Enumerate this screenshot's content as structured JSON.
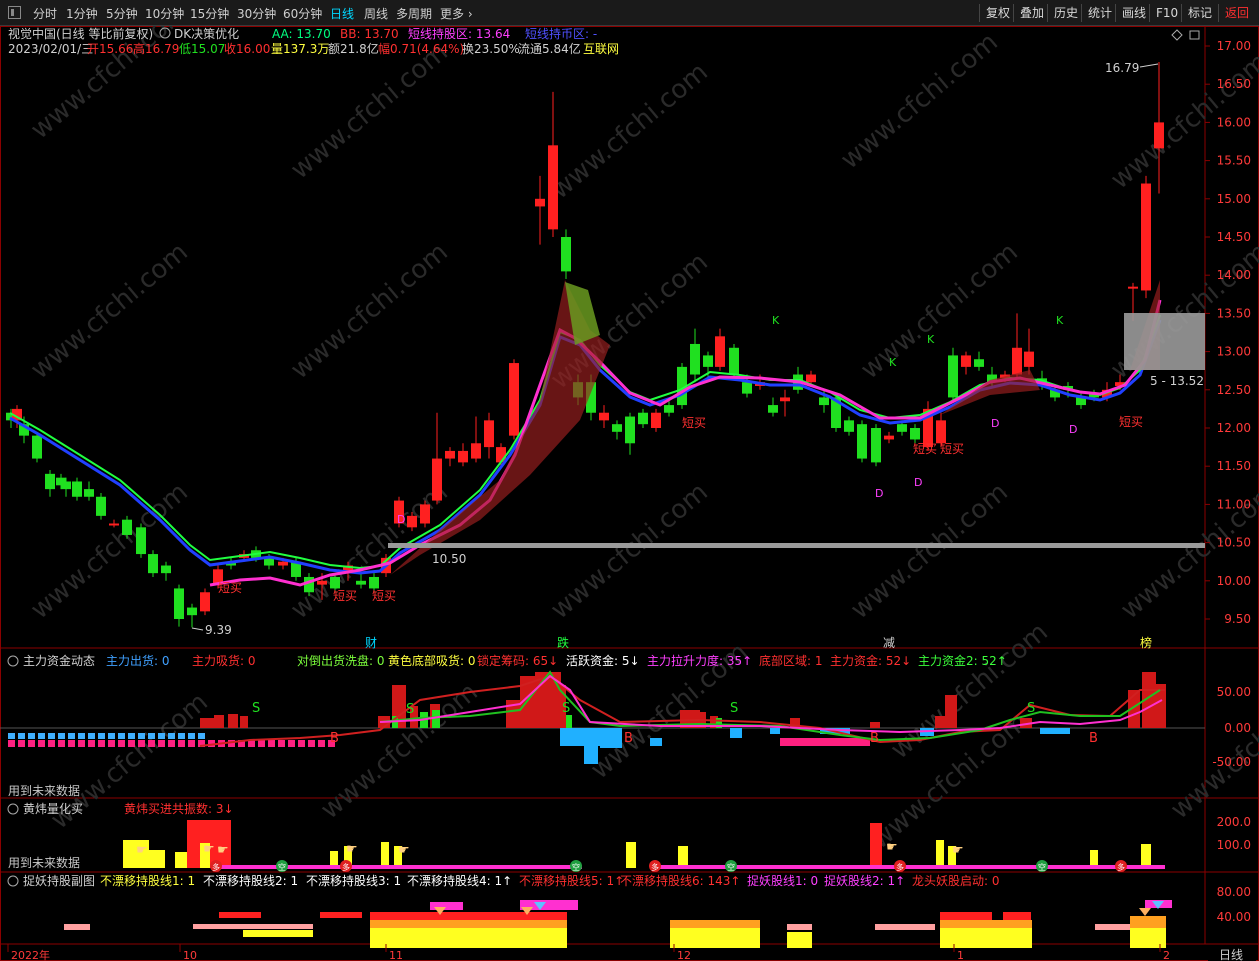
{
  "toolbar": {
    "periods": [
      "分时",
      "1分钟",
      "5分钟",
      "10分钟",
      "15分钟",
      "30分钟",
      "60分钟",
      "日线",
      "周线",
      "多周期",
      "更多"
    ],
    "active_period": "日线",
    "right_buttons": [
      "复权",
      "叠加",
      "历史",
      "统计",
      "画线",
      "F10",
      "标记",
      "返回"
    ]
  },
  "header": {
    "stock": "视觉中国(日线 等比前复权)",
    "indicator": "DK决策优化",
    "aa": "AA: 13.70",
    "bb": "BB: 13.70",
    "hold_zone": "短线持股区: 13.64",
    "coin_zone": "短线持币区: -",
    "date": "2023/02/01/三",
    "open": "开15.66",
    "high": "高16.79",
    "low": "低15.07",
    "close": "收16.00",
    "volume": "量137.3万",
    "amount": "额21.8亿",
    "change": "幅0.71(4.64%)",
    "turnover": "换23.50%",
    "float": "流通5.84亿",
    "sector": "互联网"
  },
  "price_axis": [
    "17.00",
    "16.50",
    "16.00",
    "15.50",
    "15.00",
    "14.50",
    "14.00",
    "13.50",
    "13.00",
    "12.50",
    "12.00",
    "11.50",
    "11.00",
    "10.50",
    "10.00",
    "9.50"
  ],
  "annotations": {
    "high_mark": "16.79",
    "low_mark": "9.39",
    "support": "10.50",
    "box_label": "5 - 13.52",
    "short_buy": "短买",
    "event_cai": "财",
    "event_die": "跌",
    "event_jian": "减",
    "event_bang": "榜",
    "mark_d": "D",
    "mark_k": "K",
    "mark_s": "S",
    "mark_b": "B"
  },
  "panel1": {
    "title": "主力资金动态",
    "items": [
      {
        "t": "主力出货: 0",
        "c": "#3fa0ff"
      },
      {
        "t": "主力吸货: 0",
        "c": "#ff3030"
      },
      {
        "t": "对倒出货洗盘: 0",
        "c": "#7cff3c"
      },
      {
        "t": "黄色底部吸货: 0",
        "c": "#ffff40"
      },
      {
        "t": "锁定筹码: 65↓",
        "c": "#ff3030"
      },
      {
        "t": "活跃资金: 5↓",
        "c": "#ffffff"
      },
      {
        "t": "主力拉升力度: 35↑",
        "c": "#ff40ff"
      },
      {
        "t": "底部区域: 1",
        "c": "#ff3030"
      },
      {
        "t": "主力资金: 52↓",
        "c": "#ff3030"
      },
      {
        "t": "主力资金2: 52↑",
        "c": "#3cff3c"
      }
    ],
    "axis": [
      "50.00",
      "0.00",
      "-50.00"
    ],
    "future": "用到未来数据"
  },
  "panel2": {
    "title": "黄炜量化买",
    "item": "黄炜买进共振数: 3↓",
    "axis": [
      "200.0",
      "100.0"
    ],
    "future": "用到未来数据",
    "kong": "空",
    "duo": "多"
  },
  "panel3": {
    "title": "捉妖持股副图",
    "items": [
      {
        "t": "不漂移持股线1: 1",
        "c": "#ffff40"
      },
      {
        "t": "不漂移持股线2: 1",
        "c": "#ffffff"
      },
      {
        "t": "不漂移持股线3: 1",
        "c": "#ffffff"
      },
      {
        "t": "不漂移持股线4: 1↑",
        "c": "#ffffff"
      },
      {
        "t": "不漂移持股线5: 1↑",
        "c": "#ff3030"
      },
      {
        "t": "不漂移持股线6: 143↑",
        "c": "#ff3030"
      },
      {
        "t": "捉妖股线1: 0",
        "c": "#ff40ff"
      },
      {
        "t": "捉妖股线2: 1↑",
        "c": "#ff40ff"
      },
      {
        "t": "龙头妖股启动: 0",
        "c": "#ff3030"
      }
    ],
    "axis": [
      "80.00",
      "40.00"
    ]
  },
  "time_axis": [
    "2022年",
    "10",
    "11",
    "12",
    "1",
    "2"
  ],
  "period_badge": "日线",
  "colors": {
    "up": "#ff2020",
    "down": "#20e020",
    "bg": "#000000",
    "grid": "#8b0000"
  }
}
